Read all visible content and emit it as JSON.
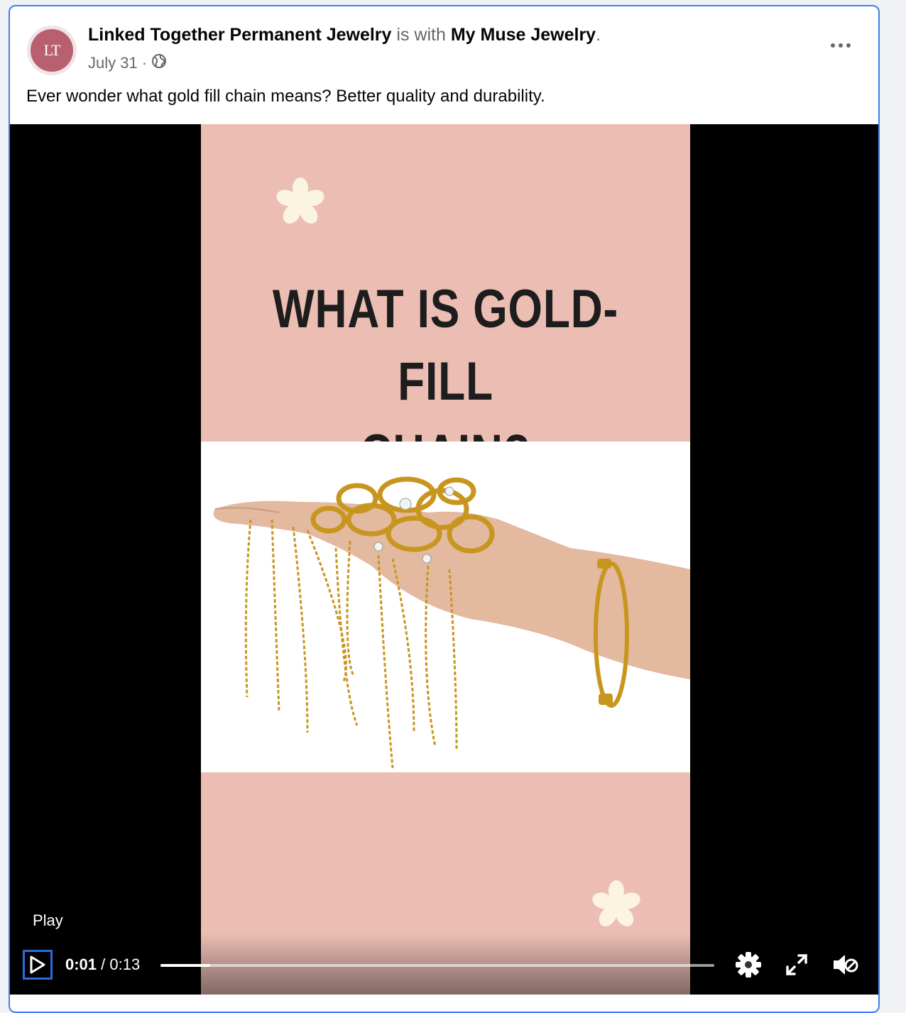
{
  "post": {
    "author": "Linked Together Permanent Jewelry",
    "with_text": "is with",
    "tagged": "My Muse Jewelry",
    "period": ".",
    "date": "July 31",
    "separator": "·",
    "avatar_text": "LT",
    "text": "Ever wonder what gold fill chain means? Better quality and durability."
  },
  "video": {
    "title_line1": "WHAT IS GOLD-FILL",
    "title_line2": "CHAIN?",
    "play_label": "Play",
    "current_time": "0:01",
    "time_separator": " / ",
    "duration": "0:13",
    "progress": 0.09
  },
  "icons": {
    "more": "more-icon",
    "globe": "globe-icon",
    "play": "play-icon",
    "settings": "gear-icon",
    "fullscreen": "fullscreen-icon",
    "mute": "muted-speaker-icon"
  },
  "colors": {
    "accent": "#3f7ef0",
    "frame_pink": "#ebbdb3",
    "title_text": "#1d1d1d"
  }
}
